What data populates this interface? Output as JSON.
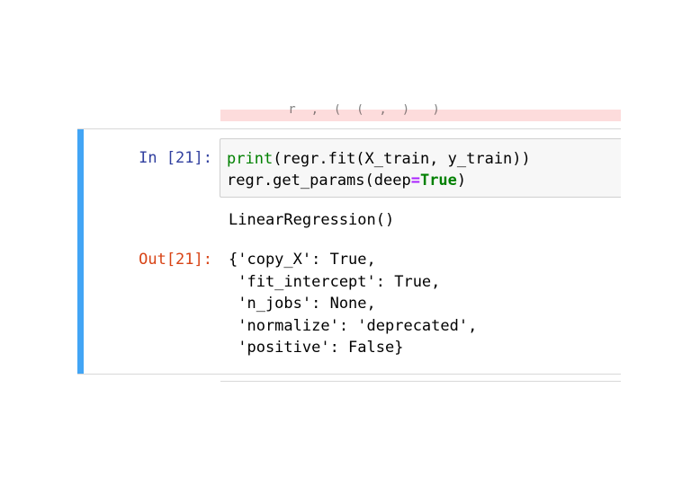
{
  "previous_cell": {
    "clipped_text": "_  r  ,  (  (  ,  )   )"
  },
  "cell": {
    "in_prompt": "In [21]:",
    "out_prompt": "Out[21]:",
    "code": {
      "line1": {
        "func": "print",
        "rest": "(regr.fit(X_train, y_train))"
      },
      "line2": {
        "before": "regr.get_params(deep",
        "op": "=",
        "value": "True",
        "after": ")"
      }
    },
    "stdout": "LinearRegression()",
    "result_lines": [
      "{'copy_X': True,",
      " 'fit_intercept': True,",
      " 'n_jobs': None,",
      " 'normalize': 'deprecated',",
      " 'positive': False}"
    ]
  },
  "colors": {
    "selected_bar": "#42a5f5",
    "in_prompt": "#303f9f",
    "out_prompt": "#d84315",
    "error_bg": "#fddcdc",
    "keyword": "#008000",
    "operator": "#aa22ff"
  }
}
